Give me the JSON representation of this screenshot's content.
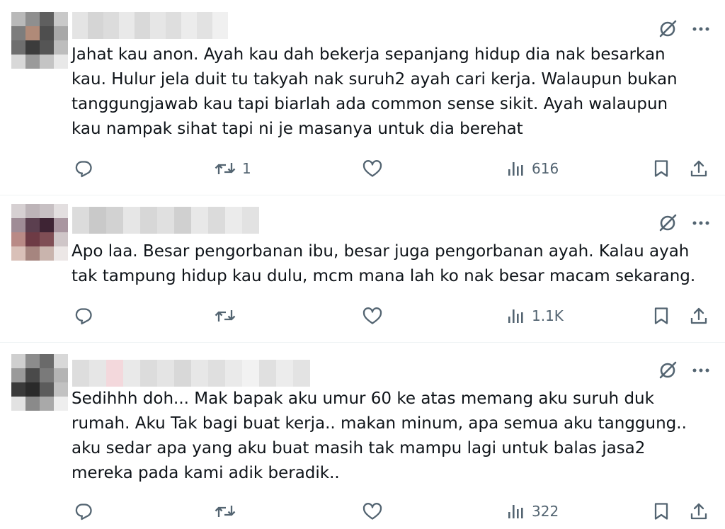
{
  "replies": [
    {
      "text": "Jahat kau anon. Ayah kau dah bekerja sepanjang hidup dia nak besarkan\nkau. Hulur jela duit tu takyah nak suruh2 ayah cari kerja. Walaupun  bukan\ntanggungjawab kau tapi biarlah ada common sense sikit. Ayah walaupun\nkau nampak sihat tapi ni je masanya untuk dia berehat",
      "retweet_count": "1",
      "views": "616"
    },
    {
      "text": "Apo laa. Besar pengorbanan ibu, besar juga pengorbanan ayah. Kalau ayah\ntak tampung hidup kau dulu, mcm mana lah ko nak besar macam sekarang.",
      "retweet_count": "",
      "views": "1.1K"
    },
    {
      "text": "Sedihhh doh... Mak bapak aku umur 60 ke atas memang aku suruh duk\nrumah. Aku Tak bagi buat kerja.. makan minum, apa semua aku tanggung..\naku sedar apa yang aku buat masih tak mampu lagi untuk balas jasa2\nmereka pada kami adik beradik..",
      "retweet_count": "",
      "views": "322"
    }
  ],
  "icons": {
    "grok": "grok-icon",
    "more": "more-icon",
    "reply": "reply-icon",
    "retweet": "retweet-icon",
    "like": "like-icon",
    "views": "views-icon",
    "bookmark": "bookmark-icon",
    "share": "share-icon"
  },
  "colors": {
    "text": "#0f1419",
    "icon_gray": "#536471",
    "divider": "#eff3f4"
  }
}
